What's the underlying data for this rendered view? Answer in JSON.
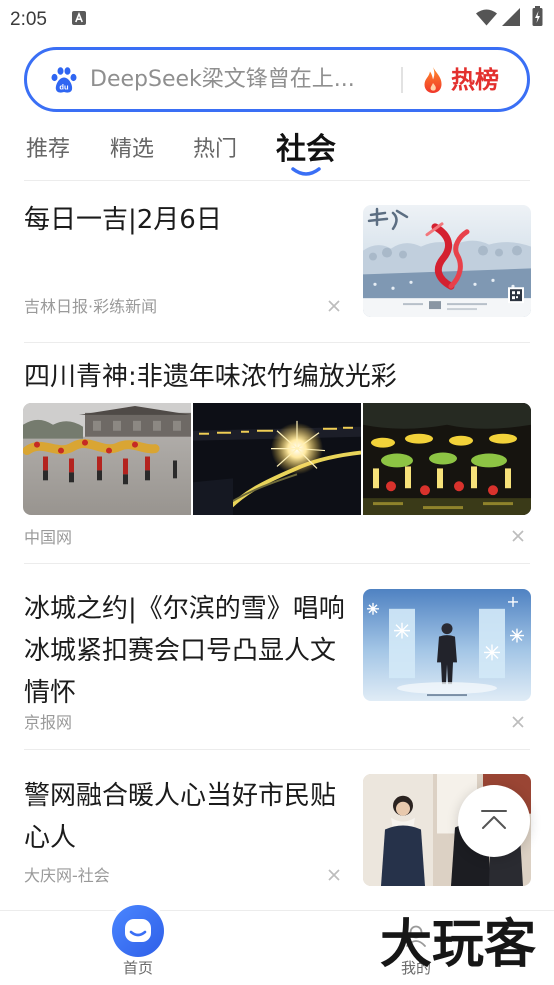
{
  "status_bar": {
    "time": "2:05"
  },
  "search": {
    "logo_text": "du",
    "query": "DeepSeek梁文锋曾在上...",
    "hot_label": "热榜"
  },
  "tabs": [
    {
      "label": "推荐",
      "active": false
    },
    {
      "label": "精选",
      "active": false
    },
    {
      "label": "热门",
      "active": false
    },
    {
      "label": "社会",
      "active": true
    }
  ],
  "feed": [
    {
      "title": "每日一吉|2月6日",
      "source": "吉林日报·彩练新闻"
    },
    {
      "title": "四川青神:非遗年味浓竹编放光彩",
      "source": "中国网"
    },
    {
      "title": "冰城之约|《尔滨的雪》唱响冰城紧扣赛会口号凸显人文情怀",
      "source": "京报网"
    },
    {
      "title": "警网融合暖人心当好市民贴心人",
      "source": "大庆网-社会"
    }
  ],
  "bottom_nav": [
    {
      "label": "首页",
      "active": true
    },
    {
      "label": "我的",
      "active": false
    }
  ],
  "watermark": "大玩客",
  "icons": {
    "notification": "font-a-icon",
    "wifi": "wifi-icon",
    "signal": "signal-icon",
    "battery": "battery-charging-icon",
    "search_logo": "baidu-paw-icon",
    "hot": "flame-icon",
    "dismiss": "close-icon",
    "back_to_top": "back-to-top-icon",
    "home": "home-face-icon",
    "profile": "user-icon"
  },
  "colors": {
    "accent": "#3a6ff5",
    "hot": "#e3302e",
    "flame": "#ff5a1f",
    "text_primary": "#1b1b1b",
    "text_secondary": "#9a9a9a",
    "tab_inactive": "#666666"
  }
}
